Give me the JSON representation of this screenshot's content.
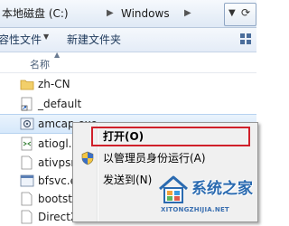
{
  "address": {
    "drive": "本地磁盘 (C:)",
    "folder": "Windows"
  },
  "toolbar": {
    "include_label": "容性文件",
    "new_folder_label": "新建文件夹"
  },
  "column": {
    "name": "名称"
  },
  "files": [
    {
      "name": "zh-CN",
      "icon": "folder-icon"
    },
    {
      "name": "_default",
      "icon": "shortcut-icon"
    },
    {
      "name": "amcap.exe",
      "icon": "exe-icon",
      "selected": true
    },
    {
      "name": "atiogl.xml",
      "icon": "xml-file-icon"
    },
    {
      "name": "ativpsrm.b",
      "icon": "file-icon"
    },
    {
      "name": "bfsvc.exe",
      "icon": "exe-icon"
    },
    {
      "name": "bootstat.d",
      "icon": "file-icon"
    },
    {
      "name": "DirectX.lo",
      "icon": "file-icon"
    }
  ],
  "context_menu": {
    "open": "打开(O)",
    "run_as_admin": "以管理员身份运行(A)",
    "send_to": "发送到(N)"
  },
  "watermark": {
    "title": "系统之家",
    "url": "XITONGZHIJIA.NET"
  },
  "colors": {
    "highlight_border": "#d0202a",
    "menu_bg": "#f0f0f0",
    "toolbar_text": "#1e395b"
  }
}
